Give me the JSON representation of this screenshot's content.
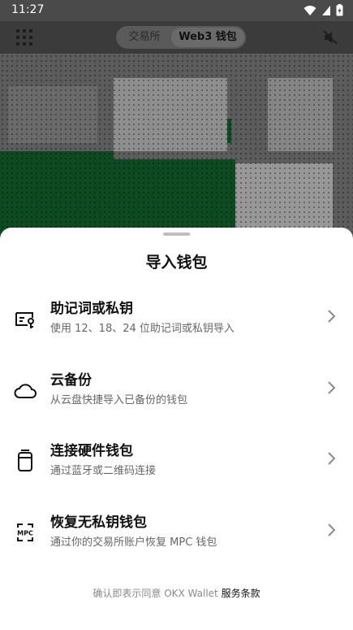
{
  "status_bar": {
    "time": "11:27"
  },
  "header": {
    "tabs": [
      {
        "label": "交易所",
        "active": false
      },
      {
        "label": "Web3 钱包",
        "active": true
      }
    ],
    "icons": [
      "menu-grid-icon",
      "mute-icon"
    ]
  },
  "sheet": {
    "title": "导入钱包",
    "options": [
      {
        "title": "助记词或私钥",
        "description": "使用 12、18、24 位助记词或私钥导入",
        "icon": "seed-phrase-key-icon"
      },
      {
        "title": "云备份",
        "description": "从云盘快捷导入已备份的钱包",
        "icon": "cloud-icon"
      },
      {
        "title": "连接硬件钱包",
        "description": "通过蓝牙或二维码连接",
        "icon": "hardware-wallet-icon"
      },
      {
        "title": "恢复无私钥钱包",
        "description": "通过你的交易所账户恢复 MPC 钱包",
        "icon": "mpc-icon",
        "icon_text": "MPC"
      }
    ],
    "terms_prefix": "确认即表示同意 OKX Wallet ",
    "terms_link": "服务条款"
  },
  "colors": {
    "sheet_bg": "#ffffff",
    "overlay": "#3b3b3b",
    "text_primary": "#111111",
    "text_secondary": "#666666"
  }
}
